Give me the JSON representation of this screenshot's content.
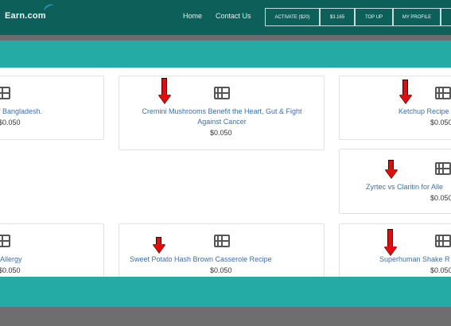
{
  "header": {
    "logo_text": "Earn.com",
    "nav_links": [
      "Home",
      "Contact Us"
    ],
    "buttons": [
      "ACTIVATE ($20)",
      "$3.165",
      "TOP UP",
      "MY PROFILE"
    ]
  },
  "cards": [
    {
      "title": "f Bangladesh.",
      "price": "$0.050"
    },
    {
      "title": "Cremini Mushrooms Benefit the Heart, Gut & Fight Against Cancer",
      "price": "$0.050"
    },
    {
      "title": "Ketchup Recipe",
      "price": "$0.050"
    },
    {
      "title": "Zyrtec vs Claritin for Alle",
      "price": "$0.050"
    },
    {
      "title": "Allergy",
      "price": "$0.050"
    },
    {
      "title": "Sweet Potato Hash Brown Casserole Recipe",
      "price": "$0.050"
    },
    {
      "title": "Superhuman Shake R",
      "price": "$0.050"
    }
  ],
  "colors": {
    "nav": "#0d5f5a",
    "teal": "#24aba6",
    "link": "#3e6fa6",
    "arrow": "#e10d0d"
  },
  "icons": [
    "film-icon",
    "red-arrow-annotation"
  ]
}
